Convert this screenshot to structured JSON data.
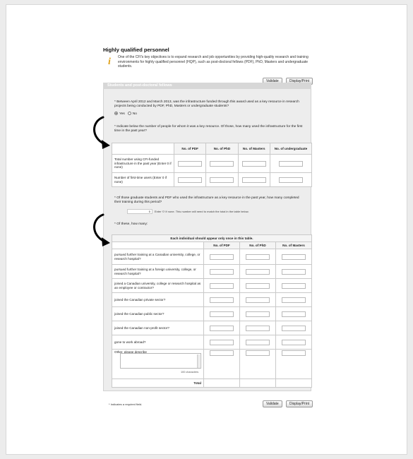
{
  "header": {
    "title": "Highly qualified personnel",
    "intro": "One of the CFI's key objectives is to expand research and job opportunities by providing high-quality research and training environments for highly qualified personnel (HQP), such as post-doctoral fellows (PDF), PhD, Masters and undergraduate students."
  },
  "toolbar": {
    "validate": "Validate",
    "display_print": "Display/Print"
  },
  "panel": {
    "title": "Students and post-doctoral fellows"
  },
  "q1": {
    "text": "* Between April 2012 and March 2013, was the infrastructure funded through this award used as a key resource in research projects being conducted by PDF, PhD, Masters or undergraduate students?",
    "yes": "Yes",
    "no": "No"
  },
  "q2": {
    "text": "* Indicate below the number of people for whom it was a key resource. Of those, how many used the infrastructure for the first time in the past year?",
    "columns": [
      "No. of PDF",
      "No. of PhD",
      "No. of Masters",
      "No. of undergraduate"
    ],
    "rows": [
      "Total number using CFI-funded infrastructure in the past year (Enter 0 if none)",
      "Number of first-time users (Enter 0 if none)"
    ]
  },
  "q3": {
    "text": "* Of those graduate students and PDF who used the infrastructure as a key resource in the past year, how many completed their training during this period?",
    "value": "0",
    "hint": "Enter '0' if none. This number will need to match the total in the table below."
  },
  "q4": {
    "text": "* Of these, how many:",
    "banner": "Each individual should appear only once in this table.",
    "columns": [
      "No. of PDF",
      "No. of PhD",
      "No. of Masters"
    ],
    "rows": [
      "pursued further training at a Canadian university, college, or research hospital?",
      "pursued further training at a foreign university, college, or research hospital?",
      "joined a Canadian university, college or research hospital as an employee or contractor?",
      "joined the Canadian private sector?",
      "joined the Canadian public sector?",
      "joined the Canadian non-profit sector?",
      "gone to work abroad?",
      "Other, please describe"
    ],
    "chars": "100 characters",
    "total": "Total"
  },
  "footer": {
    "required_note": "* Indicates a required field."
  },
  "colors": {
    "info_icon": "#e0a21a",
    "panel_bg": "#ededed",
    "panel_head": "#d7d7d7"
  }
}
